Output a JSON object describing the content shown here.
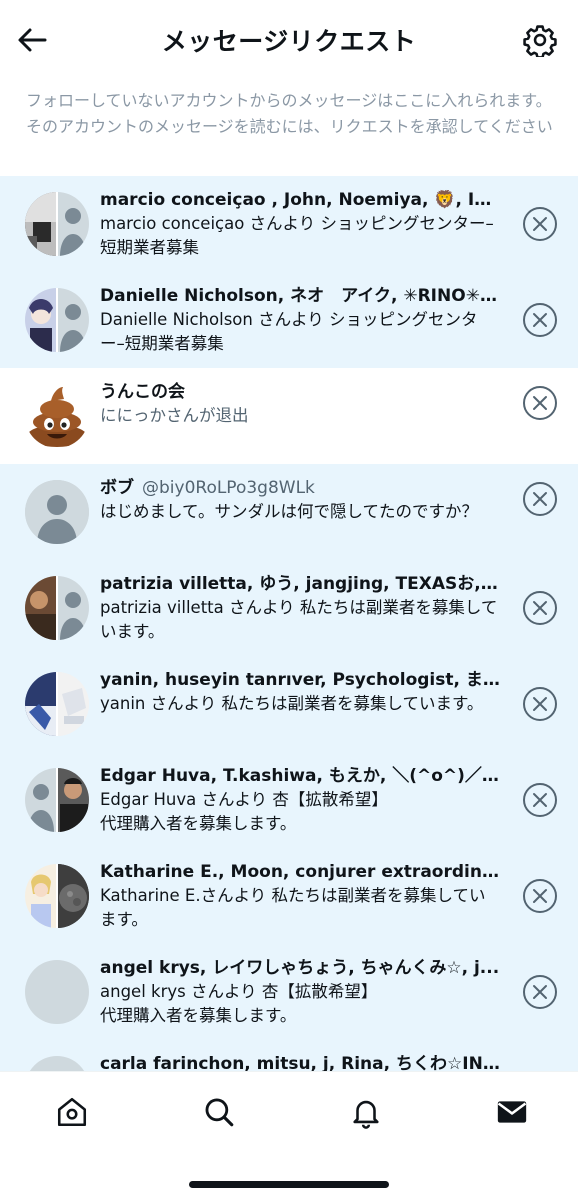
{
  "header": {
    "title": "メッセージリクエスト",
    "back_icon": "arrow-left-icon",
    "settings_icon": "gear-icon"
  },
  "intro": {
    "text": "フォローしていないアカウントからのメッセージはここに入れられます。そのアカウントのメッセージを読むには、リクエストを承認してください"
  },
  "requests": [
    {
      "title": "marcio conceiçao , John, Noemiya, 🦁, Ib...",
      "preview": "marcio conceiçao さんより ショッピングセンター–短期業者募集",
      "unread": true,
      "avatar": "group"
    },
    {
      "title": "Danielle Nicholson, ネオ　アイク, ✳RINO✳,...",
      "preview": "Danielle Nicholson さんより ショッピングセンター–短期業者募集",
      "unread": true,
      "avatar": "group"
    },
    {
      "title": "うんこの会",
      "preview": "ににっかさんが退出",
      "unread": false,
      "avatar": "poop-emoji"
    },
    {
      "title": "ボブ",
      "handle": "@biy0RoLPo3g8WLk",
      "preview": "はじめまして。サンダルは何で隠してたのですか？",
      "unread": true,
      "avatar": "default"
    },
    {
      "title": "patrizia villetta, ゆう, jangjing, TEXASお,...",
      "preview": "patrizia villetta さんより 私たちは副業者を募集しています。",
      "unread": true,
      "avatar": "group"
    },
    {
      "title": "yanin, huseyin tanrıver, Psychologist, ま…",
      "preview": "yanin さんより 私たちは副業者を募集しています。",
      "unread": true,
      "avatar": "group"
    },
    {
      "title": "Edgar Huva, T.kashiwa, もえか, ＼(^o^)／,...",
      "preview": "Edgar Huva さんより 杏【拡散希望】",
      "preview2": "代理購入者を募集します。",
      "unread": true,
      "avatar": "group"
    },
    {
      "title": "Katharine E., Moon, conjurer extraordinai...",
      "preview": "Katharine E.さんより 私たちは副業者を募集しています。",
      "unread": true,
      "avatar": "group"
    },
    {
      "title": "angel krys, レイワしゃちょう, ちゃんくみ☆, j...",
      "preview": "angel krys さんより 杏【拡散希望】",
      "preview2": "代理購入者を募集します。",
      "unread": true,
      "avatar": "blank"
    },
    {
      "title": "carla farinchon, mitsu, j, Rina, ちくわ☆IN...",
      "preview": "",
      "unread": true,
      "avatar": "blank"
    }
  ],
  "tabbar": {
    "items": [
      "home-icon",
      "search-icon",
      "bell-icon",
      "mail-icon"
    ]
  },
  "colors": {
    "unread_bg": "#e8f5fd",
    "text": "#0f1419",
    "secondary": "#536471",
    "intro_text": "#8b98a5"
  }
}
